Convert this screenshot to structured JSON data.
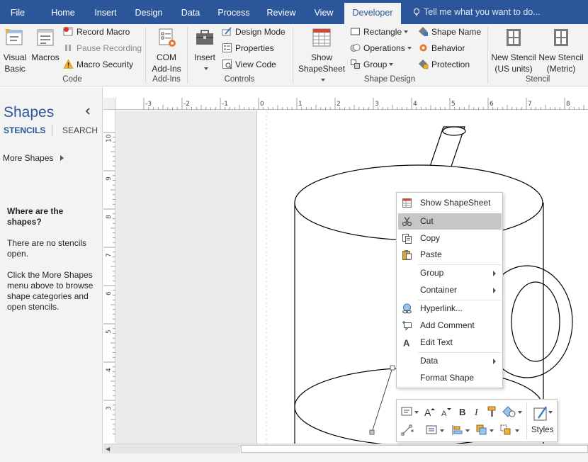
{
  "tabs": [
    {
      "label": "File",
      "active": false
    },
    {
      "label": "Home",
      "active": false
    },
    {
      "label": "Insert",
      "active": false
    },
    {
      "label": "Design",
      "active": false
    },
    {
      "label": "Data",
      "active": false
    },
    {
      "label": "Process",
      "active": false
    },
    {
      "label": "Review",
      "active": false
    },
    {
      "label": "View",
      "active": false
    },
    {
      "label": "Developer",
      "active": true
    }
  ],
  "tell_me": "Tell me what you want to do...",
  "ribbon": {
    "code": {
      "visual_basic": [
        "Visual",
        "Basic"
      ],
      "macros": "Macros",
      "record_macro": "Record Macro",
      "pause_recording": "Pause Recording",
      "macro_security": "Macro Security",
      "label": "Code"
    },
    "addins": {
      "com_addins": [
        "COM",
        "Add-Ins"
      ],
      "label": "Add-Ins"
    },
    "controls": {
      "insert": "Insert",
      "design_mode": "Design Mode",
      "properties": "Properties",
      "view_code": "View Code",
      "label": "Controls"
    },
    "shape_design": {
      "show_shapesheet": [
        "Show",
        "ShapeSheet"
      ],
      "rectangle": "Rectangle",
      "operations": "Operations",
      "group": "Group",
      "shape_name": "Shape Name",
      "behavior": "Behavior",
      "protection": "Protection",
      "label": "Shape Design"
    },
    "stencil": {
      "new_us": [
        "New Stencil",
        "(US units)"
      ],
      "new_metric": [
        "New Stencil",
        "(Metric)"
      ],
      "label": "Stencil"
    }
  },
  "shapes_pane": {
    "title": "Shapes",
    "tab_stencils": "STENCILS",
    "tab_search": "SEARCH",
    "more_shapes": "More Shapes",
    "where_title": "Where are the shapes?",
    "no_stencils": "There are no stencils open.",
    "click_more": "Click the More Shapes menu above to browse shape categories and open stencils."
  },
  "rulers": {
    "horizontal": [
      "-3",
      "-2",
      "-1",
      "0",
      "1",
      "2",
      "3",
      "4",
      "5",
      "6",
      "7",
      "8"
    ],
    "vertical": [
      "10",
      "9",
      "8",
      "7",
      "6",
      "5",
      "4",
      "3"
    ]
  },
  "context_menu": {
    "items": [
      {
        "label": "Show ShapeSheet",
        "icon": "shapesheet-icon"
      },
      {
        "label": "Cut",
        "icon": "scissors-icon",
        "hover": true
      },
      {
        "label": "Copy",
        "icon": "copy-icon"
      },
      {
        "label": "Paste",
        "icon": "paste-icon"
      },
      {
        "label": "Group",
        "submenu": true
      },
      {
        "label": "Container",
        "submenu": true
      },
      {
        "label": "Hyperlink...",
        "icon": "hyperlink-icon"
      },
      {
        "label": "Add Comment",
        "icon": "comment-icon"
      },
      {
        "label": "Edit Text",
        "icon": "text-icon"
      },
      {
        "label": "Data",
        "submenu": true
      },
      {
        "label": "Format Shape"
      }
    ]
  },
  "mini_toolbar": {
    "styles": "Styles"
  },
  "colors": {
    "accent": "#2b579a",
    "ribbon_bg": "#f3f3f3",
    "menu_hover": "#c6c6c6"
  }
}
